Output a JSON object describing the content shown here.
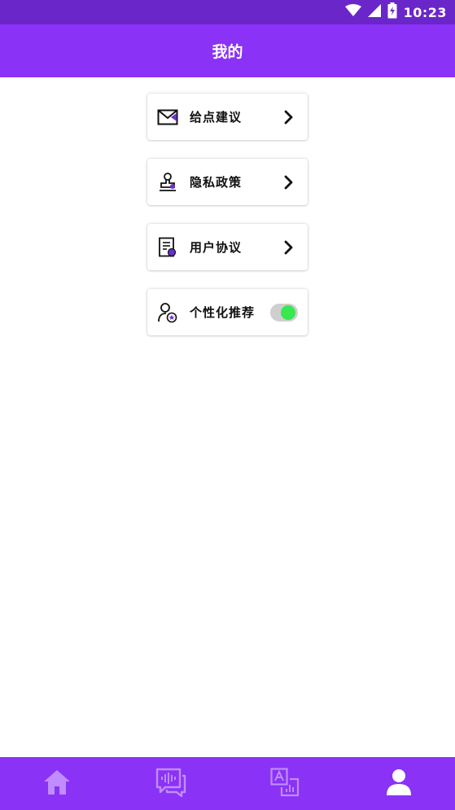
{
  "status_bar": {
    "time": "10:23",
    "icons": [
      "wifi-icon",
      "cell-signal-icon",
      "battery-icon"
    ],
    "background": "#6a26c9"
  },
  "header": {
    "title": "我的",
    "background": "#8a32f5"
  },
  "menu": {
    "items": [
      {
        "label": "给点建议",
        "icon": "envelope-icon",
        "trailing": "chevron-right-icon"
      },
      {
        "label": "隐私政策",
        "icon": "stamp-icon",
        "trailing": "chevron-right-icon"
      },
      {
        "label": "用户协议",
        "icon": "document-icon",
        "trailing": "chevron-right-icon"
      },
      {
        "label": "个性化推荐",
        "icon": "user-star-icon",
        "trailing": "toggle",
        "toggle_on": true
      }
    ]
  },
  "bottom_nav": {
    "items": [
      {
        "icon": "home-icon",
        "active": false
      },
      {
        "icon": "voice-chat-icon",
        "active": false
      },
      {
        "icon": "translate-icon",
        "active": false
      },
      {
        "icon": "profile-icon",
        "active": true
      }
    ],
    "active_color": "#ffffff",
    "inactive_color": "#c08cff",
    "background": "#8a32f5"
  },
  "colors": {
    "accent": "#8a32f5",
    "toggle_on": "#37e84f",
    "icon_accent": "#6a2fd0"
  }
}
